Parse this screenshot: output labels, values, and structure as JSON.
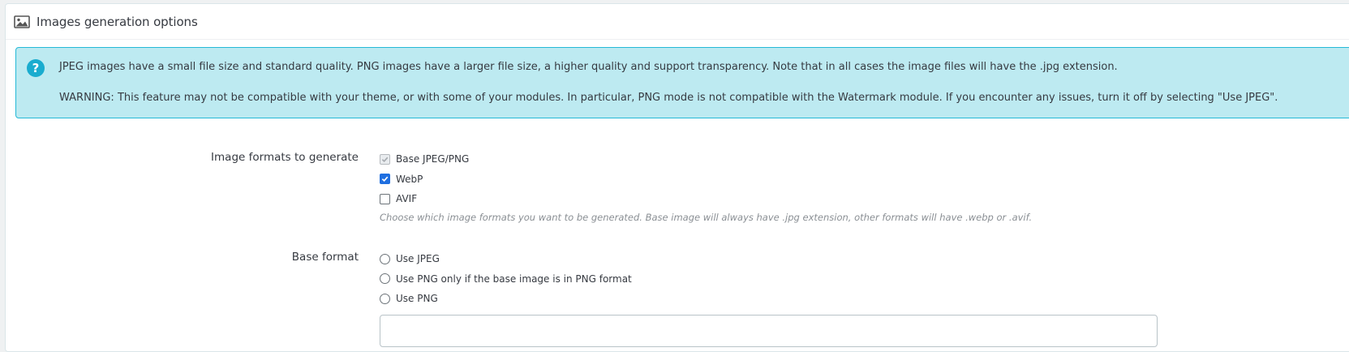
{
  "panel": {
    "title": "Images generation options",
    "icon": "image-icon"
  },
  "alert": {
    "icon": "question-circle-icon",
    "line1": "JPEG images have a small file size and standard quality. PNG images have a larger file size, a higher quality and support transparency. Note that in all cases the image files will have the .jpg extension.",
    "line2": "WARNING: This feature may not be compatible with your theme, or with some of your modules. In particular, PNG mode is not compatible with the Watermark module. If you encounter any issues, turn it off by selecting \"Use JPEG\"."
  },
  "formats": {
    "label": "Image formats to generate",
    "options": [
      {
        "label": "Base JPEG/PNG",
        "checked": true,
        "disabled": true
      },
      {
        "label": "WebP",
        "checked": true,
        "disabled": false
      },
      {
        "label": "AVIF",
        "checked": false,
        "disabled": false
      }
    ],
    "help": "Choose which image formats you want to be generated. Base image will always have .jpg extension, other formats will have .webp or .avif."
  },
  "base_format": {
    "label": "Base format",
    "options": [
      {
        "label": "Use JPEG",
        "selected": false
      },
      {
        "label": "Use PNG only if the base image is in PNG format",
        "selected": false
      },
      {
        "label": "Use PNG",
        "selected": false
      }
    ]
  },
  "colors": {
    "alert_bg": "#bdeaf1",
    "alert_border": "#25b9d7",
    "checkbox_checked": "#1f6fe0"
  }
}
